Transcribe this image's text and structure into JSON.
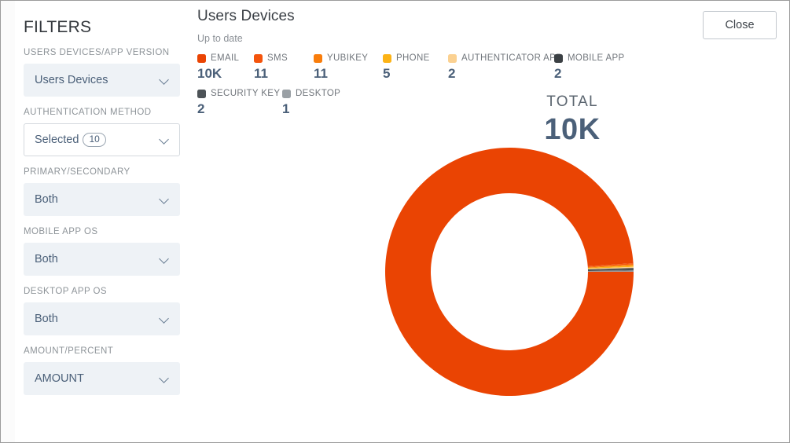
{
  "sidebar": {
    "title": "FILTERS",
    "groups": [
      {
        "label": "USERS DEVICES/APP VERSION",
        "value": "Users Devices",
        "style": "filled",
        "badge": null
      },
      {
        "label": "AUTHENTICATION METHOD",
        "value": "Selected",
        "style": "bordered",
        "badge": "10"
      },
      {
        "label": "PRIMARY/SECONDARY",
        "value": "Both",
        "style": "filled",
        "badge": null
      },
      {
        "label": "MOBILE APP OS",
        "value": "Both",
        "style": "filled",
        "badge": null
      },
      {
        "label": "DESKTOP APP OS",
        "value": "Both",
        "style": "filled",
        "badge": null
      },
      {
        "label": "AMOUNT/PERCENT",
        "value": "AMOUNT",
        "style": "filled",
        "badge": null
      }
    ]
  },
  "header": {
    "title": "Users Devices",
    "subtitle": "Up to date",
    "close_label": "Close"
  },
  "chart_data": {
    "type": "pie",
    "title": "Users Devices",
    "subtitle": "Up to date",
    "center_label": "TOTAL",
    "center_value": "10K",
    "total": 10000,
    "legend_position": "top",
    "categories": [
      "EMAIL",
      "SMS",
      "YUBIKEY",
      "PHONE",
      "AUTHENTICATOR APP",
      "MOBILE APP",
      "SECURITY KEY",
      "DESKTOP"
    ],
    "values": [
      10000,
      11,
      11,
      5,
      2,
      2,
      2,
      1
    ],
    "display_values": [
      "10K",
      "11",
      "11",
      "5",
      "2",
      "2",
      "2",
      "1"
    ],
    "colors": [
      "#ea4403",
      "#f4540c",
      "#f97d0b",
      "#fcb316",
      "#fbd191",
      "#3b4044",
      "#4d5357",
      "#9aa0a5"
    ],
    "rows": [
      [
        {
          "name": "EMAIL",
          "value": "10K",
          "color": "#ea4403"
        },
        {
          "name": "SMS",
          "value": "11",
          "color": "#f4540c"
        },
        {
          "name": "YUBIKEY",
          "value": "11",
          "color": "#f97d0b"
        },
        {
          "name": "PHONE",
          "value": "5",
          "color": "#fcb316"
        },
        {
          "name": "AUTHENTICATOR APP",
          "value": "2",
          "color": "#fbd191"
        },
        {
          "name": "MOBILE APP",
          "value": "2",
          "color": "#3b4044"
        }
      ],
      [
        {
          "name": "SECURITY KEY",
          "value": "2",
          "color": "#4d5357"
        },
        {
          "name": "DESKTOP",
          "value": "1",
          "color": "#9aa0a5"
        }
      ]
    ]
  }
}
